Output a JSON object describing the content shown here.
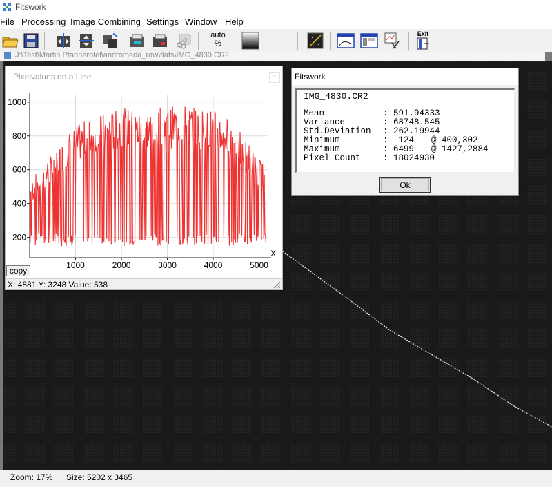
{
  "app": {
    "title": "Fitswork"
  },
  "menu": [
    "File",
    "Processing",
    "Image Combining",
    "Settings",
    "Window",
    "Help"
  ],
  "toolbar": {
    "auto_label_1": "auto",
    "auto_label_2": "%",
    "exit_label": "Exit"
  },
  "image_window": {
    "path": "J:\\Test\\Martin Pfannerotel\\andromeda_raw\\flats\\IMG_4830.CR2"
  },
  "status": {
    "zoom": "Zoom: 17%",
    "size": "Size: 5202 x 3465"
  },
  "pixel_window": {
    "title": "Pixelvalues on a Line",
    "close": "▫",
    "copy_label": "copy",
    "readout": "X: 4881  Y: 3248  Value: 538"
  },
  "stats_dialog": {
    "title": "Fitswork",
    "filename": "IMG_4830.CR2",
    "rows": [
      {
        "key": "Mean",
        "value": "591.94333",
        "loc": ""
      },
      {
        "key": "Variance",
        "value": "68748.545",
        "loc": ""
      },
      {
        "key": "Std.Deviation",
        "value": "262.19944",
        "loc": ""
      },
      {
        "key": "Minimum",
        "value": "-124",
        "loc": "@ 400,302"
      },
      {
        "key": "Maximum",
        "value": "6499",
        "loc": "@ 1427,2884"
      },
      {
        "key": "Pixel Count",
        "value": "18024930",
        "loc": ""
      }
    ],
    "separator": ":",
    "ok_label": "Ok"
  },
  "colors": {
    "series": "#ee3333",
    "workspace": "#1a1a1a"
  },
  "chart_data": {
    "type": "line",
    "xlabel": "X",
    "ylabel": "",
    "xlim": [
      0,
      5202
    ],
    "ylim": [
      80,
      1040
    ],
    "xticks": [
      1000,
      2000,
      3000,
      4000,
      5000
    ],
    "yticks": [
      200,
      400,
      600,
      800,
      1000
    ],
    "grid": true,
    "series": [
      {
        "x_start": 0,
        "x_end": 5150,
        "baseline_low": 150,
        "envelope": [
          [
            0,
            480
          ],
          [
            300,
            580
          ],
          [
            600,
            660
          ],
          [
            900,
            760
          ],
          [
            1200,
            810
          ],
          [
            1500,
            840
          ],
          [
            1800,
            860
          ],
          [
            2100,
            880
          ],
          [
            2400,
            860
          ],
          [
            2700,
            880
          ],
          [
            3000,
            880
          ],
          [
            3300,
            900
          ],
          [
            3600,
            880
          ],
          [
            3900,
            880
          ],
          [
            4200,
            850
          ],
          [
            4500,
            780
          ],
          [
            4800,
            680
          ],
          [
            5150,
            560
          ]
        ]
      }
    ]
  }
}
